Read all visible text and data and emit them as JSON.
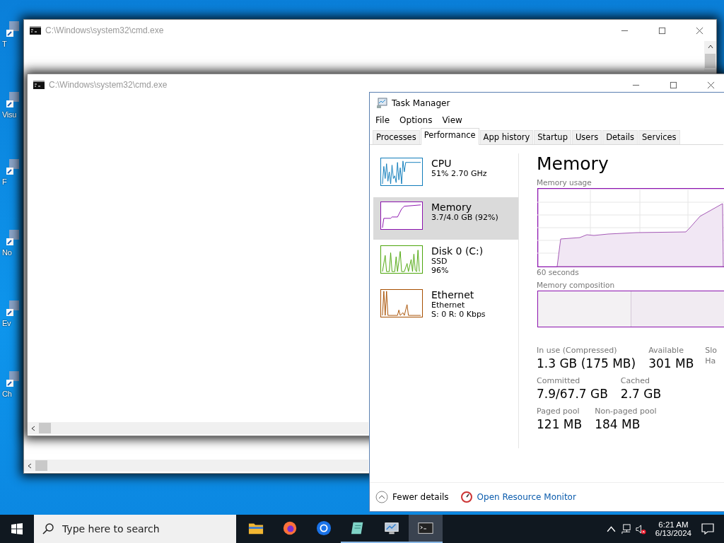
{
  "desktop_icons": [
    {
      "label": "T"
    },
    {
      "label": "Visu"
    },
    {
      "label": "F"
    },
    {
      "label": "No"
    },
    {
      "label": "Ev"
    },
    {
      "label": "Ch"
    }
  ],
  "console_windows": [
    {
      "title": "C:\\Windows\\system32\\cmd.exe"
    },
    {
      "title": "C:\\Windows\\system32\\cmd.exe"
    }
  ],
  "task_manager": {
    "title": "Task Manager",
    "menu": [
      "File",
      "Options",
      "View"
    ],
    "tabs": [
      {
        "label": "Processes",
        "selected": false
      },
      {
        "label": "Performance",
        "selected": true
      },
      {
        "label": "App history",
        "selected": false
      },
      {
        "label": "Startup",
        "selected": false
      },
      {
        "label": "Users",
        "selected": false
      },
      {
        "label": "Details",
        "selected": false
      },
      {
        "label": "Services",
        "selected": false
      }
    ],
    "resources": [
      {
        "kind": "cpu",
        "name": "CPU",
        "details": [
          "51%  2.70 GHz"
        ],
        "selected": false,
        "color": "#117dbb"
      },
      {
        "kind": "memory",
        "name": "Memory",
        "details": [
          "3.7/4.0 GB (92%)"
        ],
        "selected": true,
        "color": "#8b12ae"
      },
      {
        "kind": "disk",
        "name": "Disk 0 (C:)",
        "details": [
          "SSD",
          "96%"
        ],
        "selected": false,
        "color": "#4da60c"
      },
      {
        "kind": "network",
        "name": "Ethernet",
        "details": [
          "Ethernet",
          "S: 0  R: 0 Kbps"
        ],
        "selected": false,
        "color": "#a74f01"
      }
    ],
    "heading": "Memory",
    "usage_label": "Memory usage",
    "time_label": "60 seconds",
    "composition_label": "Memory composition",
    "stat_rows": [
      {
        "stats": [
          {
            "label": "In use (Compressed)",
            "value": "1.3 GB (175 MB)"
          },
          {
            "label": "Available",
            "value": "301 MB"
          }
        ],
        "side_labels": [
          "Slo",
          "Ha"
        ]
      },
      {
        "stats": [
          {
            "label": "Committed",
            "value": "7.9/67.7 GB"
          },
          {
            "label": "Cached",
            "value": "2.7 GB"
          }
        ]
      },
      {
        "stats": [
          {
            "label": "Paged pool",
            "value": "121 MB"
          },
          {
            "label": "Non-paged pool",
            "value": "184 MB"
          }
        ]
      }
    ],
    "fewer_details": "Fewer details",
    "resource_monitor_link": "Open Resource Monitor"
  },
  "taskbar": {
    "search_placeholder": "Type here to search",
    "apps": [
      {
        "kind": "folder",
        "running": false,
        "active": false
      },
      {
        "kind": "browser-orange",
        "running": false,
        "active": false
      },
      {
        "kind": "browser-blue",
        "running": false,
        "active": false
      },
      {
        "kind": "notepad",
        "running": true,
        "active": false
      },
      {
        "kind": "monitor",
        "running": true,
        "active": false
      },
      {
        "kind": "console",
        "running": true,
        "active": true
      }
    ],
    "time": "6:21 AM",
    "date": "6/13/2024"
  }
}
